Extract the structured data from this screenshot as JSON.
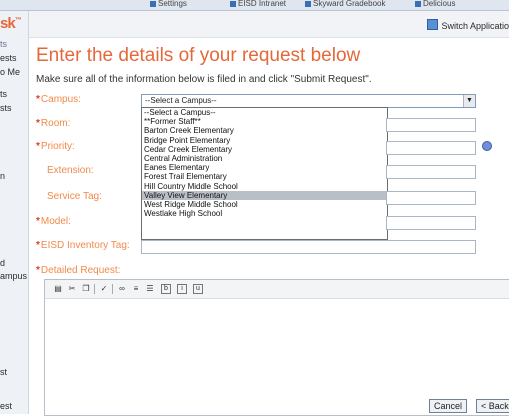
{
  "topbar": {
    "items": [
      "Settings",
      "EISD Intranet",
      "Skyward Gradebook",
      "Delicious"
    ]
  },
  "leftnav": {
    "brand": "sk",
    "items": [
      "ts",
      "ests",
      "o Me",
      "ts",
      "sts",
      "n",
      "d",
      "ampus",
      "st",
      "est"
    ]
  },
  "header": {
    "switch_app": "Switch Applicatio"
  },
  "form": {
    "title": "Enter the details of your request below",
    "instructions": "Make sure all of the information below is filed in and click \"Submit Request\".",
    "labels": {
      "campus": "Campus:",
      "room": "Room:",
      "priority": "Priority:",
      "extension": "Extension:",
      "service_tag": "Service Tag:",
      "model": "Model:",
      "inventory_tag": "EISD Inventory Tag:",
      "detailed_request": "Detailed Request:"
    },
    "campus_selected": "--Select a Campus--",
    "campus_options": [
      "--Select a Campus--",
      "**Former Staff**",
      "Barton Creek Elementary",
      "Bridge Point Elementary",
      "Cedar Creek Elementary",
      "Central Administration",
      "Eanes Elementary",
      "Forest Trail Elementary",
      "Hill Country Middle School",
      "Valley View Elementary",
      "West Ridge Middle School",
      "Westlake High School"
    ],
    "highlighted_option_index": 9
  },
  "editor": {
    "toolbar_icons": [
      "paste-icon",
      "cut-icon",
      "copy-icon",
      "spellcheck-icon",
      "link-icon",
      "ordered-list-icon",
      "unordered-list-icon",
      "bold-icon",
      "italic-icon",
      "underline-icon"
    ]
  },
  "buttons": {
    "cancel": "Cancel",
    "back": "< Back"
  },
  "colors": {
    "accent": "#e5683a",
    "label": "#f08a4b",
    "required": "#e23d2a"
  }
}
